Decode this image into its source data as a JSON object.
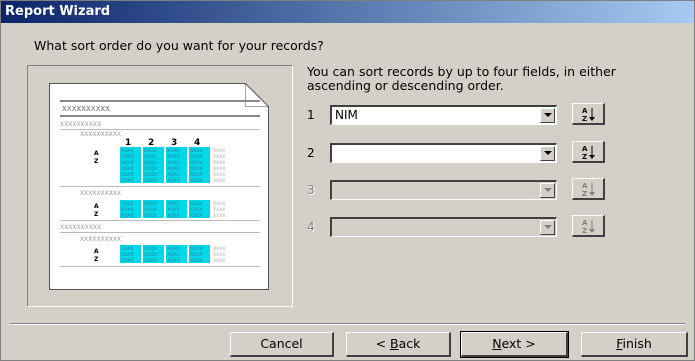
{
  "window": {
    "title": "Report Wizard"
  },
  "question": "What sort order do you want for your records?",
  "description": "You can sort records by up to four fields, in either ascending or descending order.",
  "preview": {
    "placeholder_long": "XXXXXXXXXX",
    "placeholder_cell": "XXXX",
    "column_numbers": [
      "1",
      "2",
      "3",
      "4"
    ],
    "sort_label": "A Z"
  },
  "sort_fields": [
    {
      "number": "1",
      "value": "NIM",
      "enabled": true
    },
    {
      "number": "2",
      "value": "",
      "enabled": true
    },
    {
      "number": "3",
      "value": "",
      "enabled": false
    },
    {
      "number": "4",
      "value": "",
      "enabled": false
    }
  ],
  "buttons": {
    "cancel": "Cancel",
    "back_prefix": "< ",
    "back_mnemonic": "B",
    "back_rest": "ack",
    "next_mnemonic": "N",
    "next_rest": "ext >",
    "finish_mnemonic": "F",
    "finish_rest": "inish"
  },
  "colors": {
    "titlebar": "#0a246a",
    "highlight": "#00d8e8",
    "dialog_bg": "#d4d0c8"
  }
}
